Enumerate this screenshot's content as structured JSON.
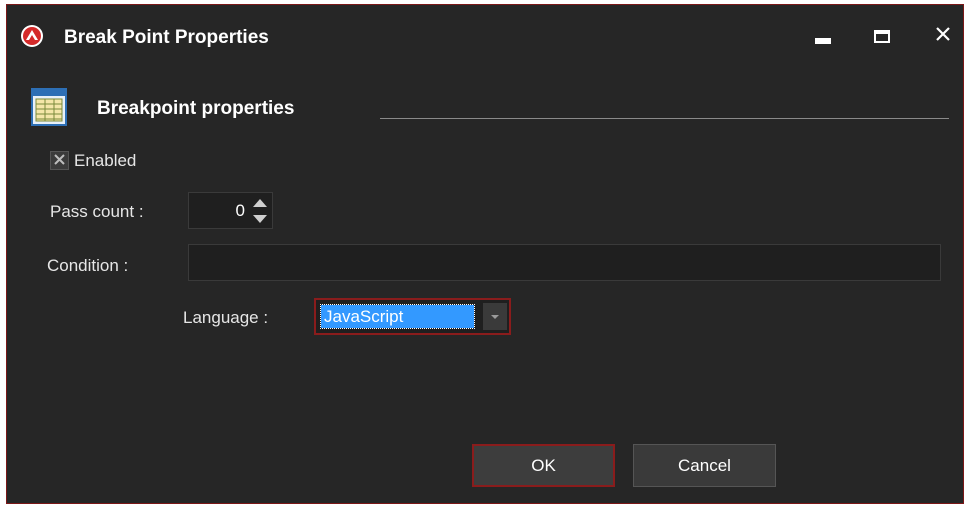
{
  "window": {
    "title": "Break Point Properties",
    "accent": "#8a1c1c",
    "icons": {
      "app": "app-logo-icon",
      "minimize": "minimize-icon",
      "maximize": "maximize-icon",
      "close": "close-icon"
    }
  },
  "group": {
    "title": "Breakpoint properties",
    "icon": "properties-table-icon"
  },
  "form": {
    "enabled": {
      "label": "Enabled",
      "checked": true
    },
    "pass_count": {
      "label": "Pass count :",
      "value": "0"
    },
    "condition": {
      "label": "Condition :",
      "value": ""
    },
    "language": {
      "label": "Language :",
      "value": "JavaScript"
    }
  },
  "buttons": {
    "ok": "OK",
    "cancel": "Cancel"
  },
  "colors": {
    "background": "#262626",
    "selection": "#3399ff",
    "focus_border": "#8a1c1c"
  }
}
